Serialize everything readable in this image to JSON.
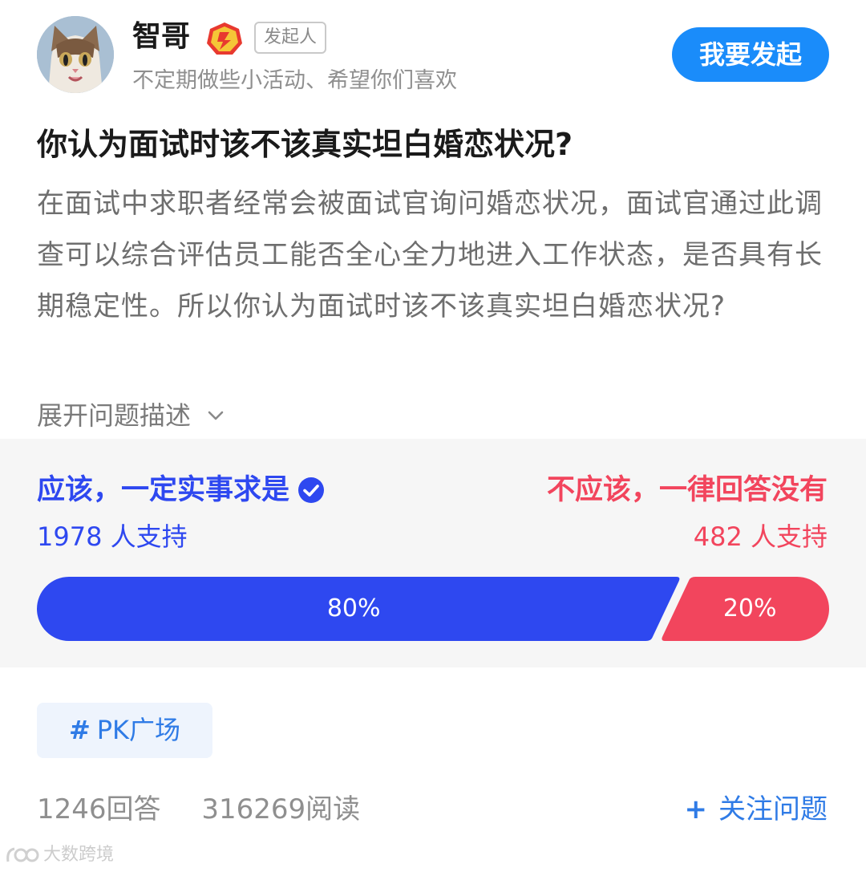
{
  "header": {
    "author_name": "智哥",
    "role_tag": "发起人",
    "author_sub": "不定期做些小活动、希望你们喜欢",
    "launch_button": "我要发起"
  },
  "question": {
    "title": "你认为面试时该不该真实坦白婚恋状况?",
    "description": "在面试中求职者经常会被面试官询问婚恋状况，面试官通过此调查可以综合评估员工能否全心全力地进入工作状态，是否具有长期稳定性。所以你认为面试时该不该真实坦白婚恋状况?",
    "expand_label": "展开问题描述"
  },
  "pk": {
    "side_a": {
      "label": "应该，一定实事求是",
      "count": "1978 人支持",
      "percent_label": "80%",
      "percent": 80,
      "color": "#2e48f0"
    },
    "side_b": {
      "label": "不应该，一律回答没有",
      "count": "482 人支持",
      "percent_label": "20%",
      "percent": 20,
      "color": "#f2455d"
    }
  },
  "topic": {
    "hash": "#",
    "label": "PK广场"
  },
  "stats": {
    "answers": "1246回答",
    "reads": "316269阅读",
    "follow_label": "关注问题",
    "follow_plus": "+"
  },
  "watermark": {
    "text": "大数跨境"
  },
  "icons": {
    "avatar": "cat-avatar",
    "badge": "creator-badge-icon",
    "check": "check-circle-icon",
    "chevron": "chevron-down-icon"
  }
}
